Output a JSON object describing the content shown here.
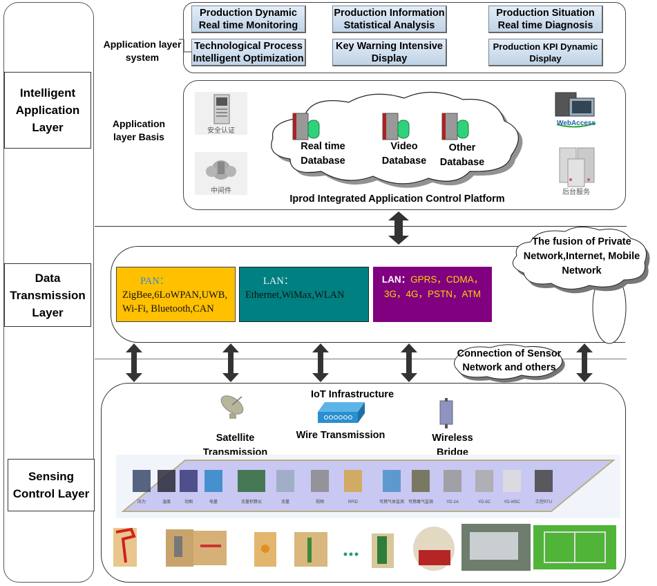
{
  "layers": {
    "intelligent_application": "Intelligent Application Layer",
    "data_transmission": "Data Transmission Layer",
    "sensing_control": "Sensing Control Layer"
  },
  "application_layer_system": {
    "label": "Application layer system",
    "modules": [
      "Production Dynamic Real time Monitoring",
      "Production Information Statistical Analysis",
      "Production Situation Real time Diagnosis",
      "Technological Process Intelligent Optimization",
      "Key Warning Intensive Display",
      "Production KPI Dynamic Display"
    ]
  },
  "application_layer_basis": {
    "label": "Application layer Basis",
    "left_icons": [
      "安全认证",
      "中间件"
    ],
    "right_icons": [
      "WebAccess",
      "后台服务"
    ],
    "databases": [
      "Real time Database",
      "Video Database",
      "Other Database"
    ],
    "platform": "Iprod Integrated Application Control Platform"
  },
  "data_transmission": {
    "pan": {
      "prefix": "PAN：",
      "text": "ZigBee,6LoWPAN,UWB, Wi-Fi, Bluetooth,CAN",
      "color": "#ffc000"
    },
    "lan": {
      "prefix": "LAN：",
      "text": "Ethernet,WiMax,WLAN",
      "color": "#008080"
    },
    "wan": {
      "prefix": "LAN：",
      "text": "GPRS，CDMA，3G，4G，PSTN，ATM",
      "color": "#800080"
    },
    "fusion_cloud": "The fusion of Private Network,Internet, Mobile Network",
    "sensor_cloud": "Connection of Sensor Network and others"
  },
  "sensing": {
    "iot_infrastructure": "IoT Infrastructure",
    "items": [
      "Satellite Transmission",
      "Wire Transmission",
      "Wireless Bridge"
    ],
    "devices": [
      "压力",
      "温度",
      "功图",
      "电量",
      "流量积算仪",
      "流量",
      "视频",
      "RFID",
      "可燃气体监测",
      "可燃毒气监测",
      "YD-2A",
      "YD-5C",
      "YD-W5C",
      "工控RTU"
    ],
    "ellipsis": "..."
  }
}
